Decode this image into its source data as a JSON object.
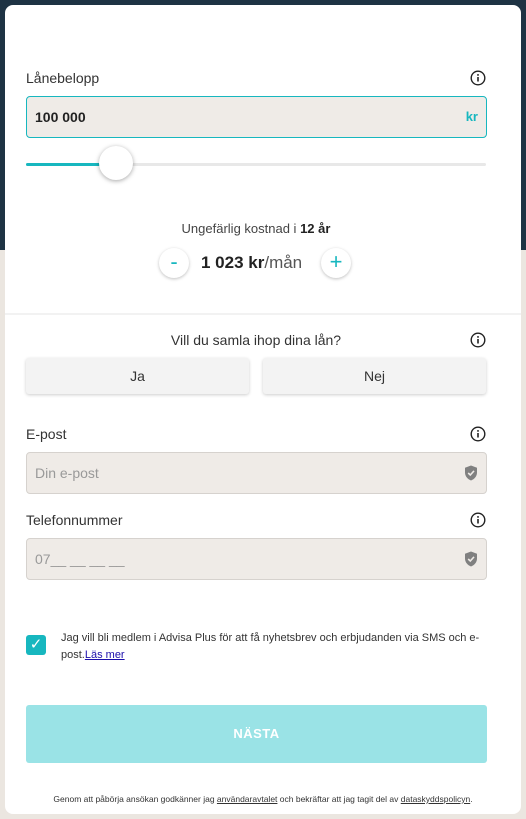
{
  "loan": {
    "label": "Lånebelopp",
    "amount_value": "100 000",
    "currency": "kr",
    "slider_fraction": 0.16
  },
  "cost": {
    "prefix": "Ungefärlig kostnad i",
    "years": "12 år",
    "minus": "-",
    "plus": "+",
    "amount": "1 023 kr",
    "per": "/mån"
  },
  "consolidate": {
    "question": "Vill du samla ihop dina lån?",
    "yes": "Ja",
    "no": "Nej"
  },
  "email": {
    "label": "E-post",
    "placeholder": "Din e-post"
  },
  "phone": {
    "label": "Telefonnummer",
    "placeholder": "07__ __ __ __"
  },
  "consent": {
    "text": "Jag vill bli medlem i Advisa Plus för att få nyhetsbrev och erbjudanden via SMS och e-post.",
    "link": "Läs mer",
    "checked": true
  },
  "next_button": "NÄSTA",
  "footer": {
    "part1": "Genom att påbörja ansökan godkänner jag ",
    "terms_link": "användaravtalet",
    "part2": " och bekräftar att jag tagit del av ",
    "privacy_link": "dataskyddspolicyn",
    "part3": "."
  },
  "colors": {
    "accent": "#17b7bf",
    "header_bg": "#1e3344",
    "field_bg": "#efebe7",
    "button_disabled": "#9ae3e6"
  },
  "icons": [
    "info-icon",
    "shield-icon",
    "checkmark-icon"
  ]
}
